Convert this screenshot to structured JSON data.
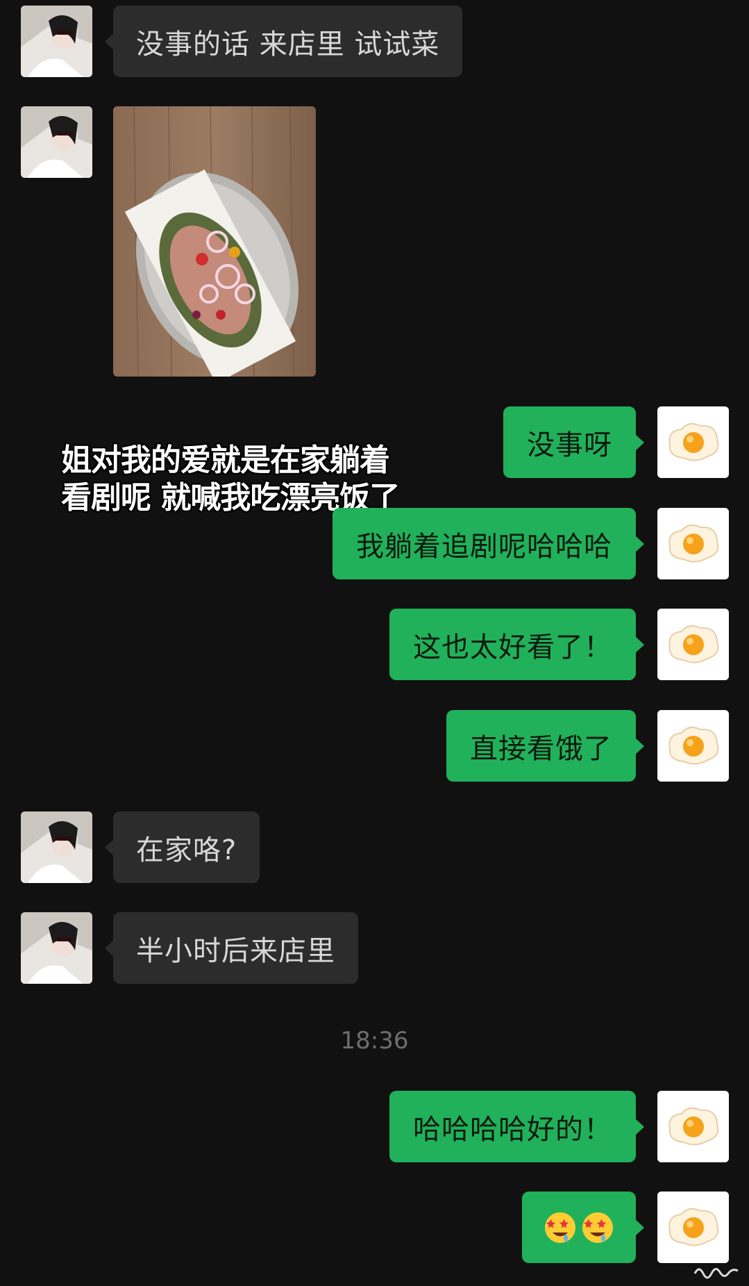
{
  "chat": {
    "messages": [
      {
        "side": "left",
        "type": "text",
        "text": "没事的话 来店里 试试菜"
      },
      {
        "side": "left",
        "type": "image",
        "image_label": "food-photo"
      },
      {
        "side": "right",
        "type": "text",
        "text": "没事呀"
      },
      {
        "side": "right",
        "type": "text",
        "text": "我躺着追剧呢哈哈哈"
      },
      {
        "side": "right",
        "type": "text",
        "text": "这也太好看了！"
      },
      {
        "side": "right",
        "type": "text",
        "text": "直接看饿了"
      },
      {
        "side": "left",
        "type": "text",
        "text": "在家咯?"
      },
      {
        "side": "left",
        "type": "text",
        "text": "半小时后来店里"
      },
      {
        "side": "right",
        "type": "text",
        "text": "哈哈哈哈好的！"
      },
      {
        "side": "right",
        "type": "emoji",
        "emoji_icons": [
          "star-struck-drool-icon",
          "star-struck-drool-icon"
        ]
      }
    ],
    "timestamp": "18:36",
    "avatars": {
      "left": "woman-portrait-avatar",
      "right": "fried-egg-avatar"
    }
  },
  "caption": {
    "line1": "姐对我的爱就是在家躺着",
    "line2": "看剧呢 就喊我吃漂亮饭了"
  },
  "colors": {
    "background": "#111111",
    "bubble_left": "#2c2c2c",
    "bubble_right": "#21b15a",
    "timestamp": "#6e6e6e"
  }
}
